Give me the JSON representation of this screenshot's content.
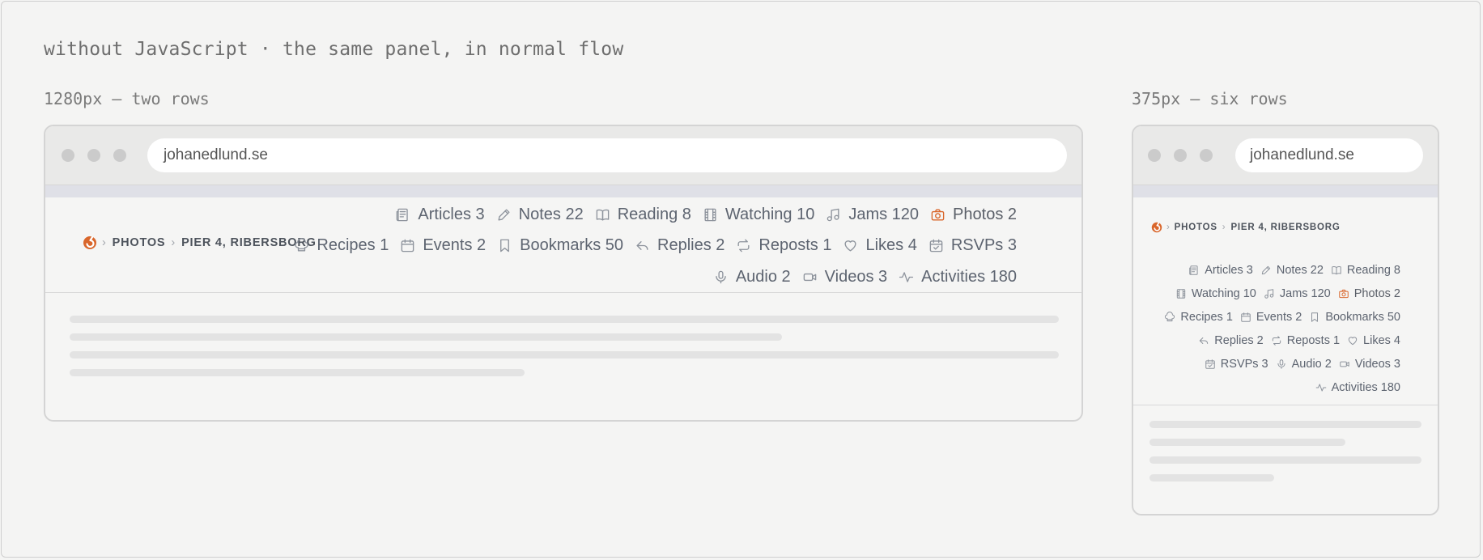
{
  "heading": "without JavaScript · the same panel, in normal flow",
  "wide": {
    "caption": "1280px — two rows",
    "url": "johanedlund.se"
  },
  "narrow": {
    "caption": "375px — six rows",
    "url": "johanedlund.se"
  },
  "breadcrumb": {
    "section": "PHOTOS",
    "page": "PIER 4, RIBERSBORG"
  },
  "nav": [
    {
      "label": "Articles 3",
      "icon": "articles-icon"
    },
    {
      "label": "Notes 22",
      "icon": "pencil-icon"
    },
    {
      "label": "Reading 8",
      "icon": "book-icon"
    },
    {
      "label": "Watching 10",
      "icon": "film-icon"
    },
    {
      "label": "Jams 120",
      "icon": "music-icon"
    },
    {
      "label": "Photos 2",
      "icon": "camera-icon",
      "active": true
    },
    {
      "label": "Recipes 1",
      "icon": "chef-hat-icon"
    },
    {
      "label": "Events 2",
      "icon": "calendar-icon"
    },
    {
      "label": "Bookmarks 50",
      "icon": "bookmark-icon"
    },
    {
      "label": "Replies 2",
      "icon": "reply-icon"
    },
    {
      "label": "Reposts 1",
      "icon": "repost-icon"
    },
    {
      "label": "Likes 4",
      "icon": "heart-icon"
    },
    {
      "label": "RSVPs 3",
      "icon": "calendar-check-icon"
    },
    {
      "label": "Audio 2",
      "icon": "microphone-icon"
    },
    {
      "label": "Videos 3",
      "icon": "video-icon"
    },
    {
      "label": "Activities 180",
      "icon": "activity-icon"
    }
  ],
  "colors": {
    "accent": "#d9662b",
    "icon": "#8d939c"
  }
}
